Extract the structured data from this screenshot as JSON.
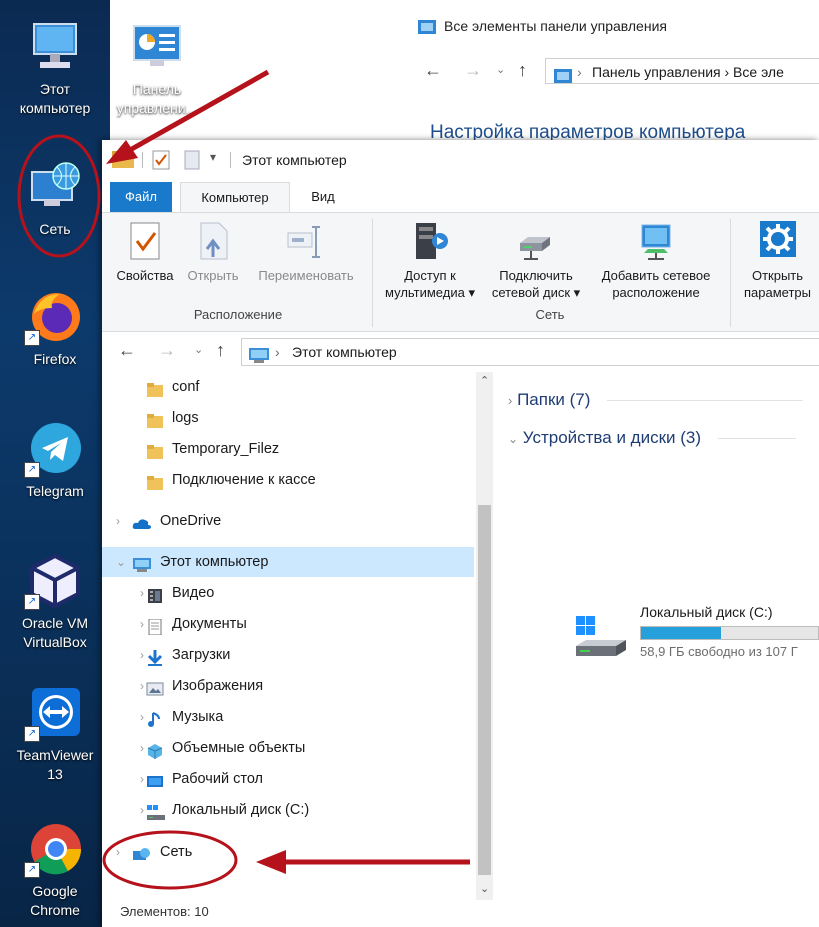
{
  "desktop": {
    "icons": [
      {
        "label_line1": "Этот",
        "label_line2": "компьютер",
        "icon": "computer-icon"
      },
      {
        "label_line1": "Панель",
        "label_line2": "управлени...",
        "icon": "control-panel-icon"
      },
      {
        "label_line1": "Сеть",
        "label_line2": "",
        "icon": "network-icon"
      },
      {
        "label_line1": "Firefox",
        "label_line2": "",
        "icon": "firefox-icon"
      },
      {
        "label_line1": "Telegram",
        "label_line2": "",
        "icon": "telegram-icon"
      },
      {
        "label_line1": "Oracle VM",
        "label_line2": "VirtualBox",
        "icon": "virtualbox-icon"
      },
      {
        "label_line1": "TeamViewer",
        "label_line2": "13",
        "icon": "teamviewer-icon"
      },
      {
        "label_line1": "Google",
        "label_line2": "Chrome",
        "icon": "chrome-icon"
      }
    ],
    "shortcut_glyph": "↗"
  },
  "control_panel": {
    "title": "Все элементы панели управления",
    "address": "Панель управления  ›  Все эле",
    "heading": "Настройка параметров компьютера"
  },
  "explorer": {
    "title": "Этот компьютер",
    "tabs": {
      "file": "Файл",
      "computer": "Компьютер",
      "view": "Вид"
    },
    "ribbon": {
      "properties": "Свойства",
      "open": "Открыть",
      "rename": "Переименовать",
      "media_access_1": "Доступ к",
      "media_access_2": "мультимедиа ▾",
      "map_drive_1": "Подключить",
      "map_drive_2": "сетевой диск ▾",
      "add_location_1": "Добавить сетевое",
      "add_location_2": "расположение",
      "open_settings_1": "Открыть",
      "open_settings_2": "параметры",
      "group_location": "Расположение",
      "group_network": "Сеть"
    },
    "address": "Этот компьютер",
    "tree": [
      {
        "label": "conf",
        "type": "folder"
      },
      {
        "label": "logs",
        "type": "folder"
      },
      {
        "label": "Temporary_Filez",
        "type": "folder"
      },
      {
        "label": "Подключение к кассе",
        "type": "folder"
      },
      {
        "label": "OneDrive",
        "type": "onedrive"
      },
      {
        "label": "Этот компьютер",
        "type": "computer"
      },
      {
        "label": "Видео",
        "type": "video"
      },
      {
        "label": "Документы",
        "type": "documents"
      },
      {
        "label": "Загрузки",
        "type": "downloads"
      },
      {
        "label": "Изображения",
        "type": "pictures"
      },
      {
        "label": "Музыка",
        "type": "music"
      },
      {
        "label": "Объемные объекты",
        "type": "3d"
      },
      {
        "label": "Рабочий стол",
        "type": "desktop"
      },
      {
        "label": "Локальный диск (C:)",
        "type": "drive"
      },
      {
        "label": "Сеть",
        "type": "network"
      }
    ],
    "groups": {
      "folders": "Папки (7)",
      "devices": "Устройства и диски (3)"
    },
    "drive": {
      "name": "Локальный диск (C:)",
      "free": "58,9 ГБ свободно из 107 Г",
      "used_fraction": 0.45
    },
    "status": "Элементов: 10"
  },
  "colors": {
    "accent": "#1979ca",
    "annotation": "#b5121b",
    "selection": "#cce8ff"
  }
}
